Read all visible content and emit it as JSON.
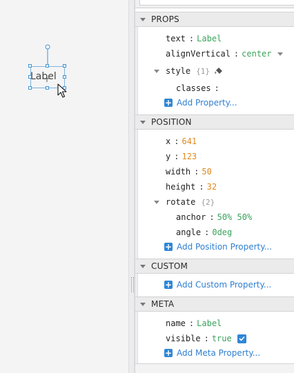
{
  "canvas": {
    "component_label": "Label"
  },
  "sections": {
    "props": {
      "title": "PROPS",
      "text_key": "text",
      "text_value": "Label",
      "alignVertical_key": "alignVertical",
      "alignVertical_value": "center",
      "style_key": "style",
      "style_count": "{1}",
      "classes_key": "classes",
      "add_label": "Add Property..."
    },
    "position": {
      "title": "POSITION",
      "x_key": "x",
      "x_value": "641",
      "y_key": "y",
      "y_value": "123",
      "width_key": "width",
      "width_value": "50",
      "height_key": "height",
      "height_value": "32",
      "rotate_key": "rotate",
      "rotate_count": "{2}",
      "anchor_key": "anchor",
      "anchor_value": "50% 50%",
      "angle_key": "angle",
      "angle_value": "0deg",
      "add_label": "Add Position Property..."
    },
    "custom": {
      "title": "CUSTOM",
      "add_label": "Add Custom Property..."
    },
    "meta": {
      "title": "META",
      "name_key": "name",
      "name_value": "Label",
      "visible_key": "visible",
      "visible_value": "true",
      "add_label": "Add Meta Property..."
    }
  },
  "icons": {
    "collapse": "chevron-down-icon",
    "expand": "triangle-down-icon",
    "add": "plus-icon",
    "style_edit": "paint-bucket-icon",
    "checkbox": "checkbox-checked-icon",
    "cursor": "pointer-cursor-icon",
    "move": "move-crosshair-icon"
  },
  "colors": {
    "key_text": "#1f1f1f",
    "string_value": "#3aa35b",
    "number_value": "#e0891f",
    "count_hint": "#9a9a9a",
    "link": "#2f7fd1",
    "selection": "#3d94d6",
    "section_header_bg": "#ebebec"
  }
}
